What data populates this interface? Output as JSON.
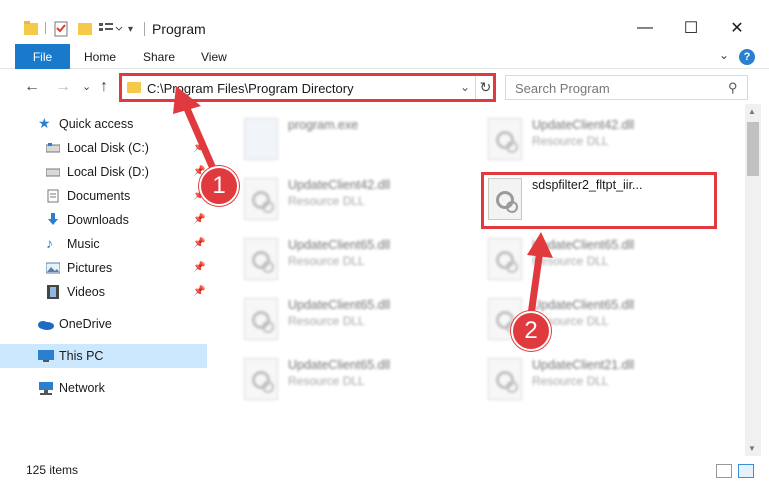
{
  "window": {
    "title": "Program",
    "minimize_glyph": "—",
    "maximize_glyph": "☐",
    "close_glyph": "✕"
  },
  "ribbon": {
    "file_tab": "File",
    "tabs": [
      "Home",
      "Share",
      "View"
    ],
    "help_glyph": "?",
    "expand_glyph": "⌄"
  },
  "nav": {
    "back_glyph": "←",
    "forward_glyph": "→",
    "recent_glyph": "⌄",
    "up_glyph": "↑",
    "address": "C:\\Program Files\\Program Directory",
    "address_drop_glyph": "⌄",
    "refresh_glyph": "↻",
    "search_placeholder": "Search Program",
    "search_glyph": "⚲"
  },
  "sidebar": {
    "items": [
      {
        "label": "Quick access",
        "icon": "star-icon",
        "pinned": false
      },
      {
        "label": "Local Disk (C:)",
        "icon": "drive-icon",
        "pinned": true
      },
      {
        "label": "Local Disk (D:)",
        "icon": "drive-icon",
        "pinned": true
      },
      {
        "label": "Documents",
        "icon": "documents-icon",
        "pinned": true
      },
      {
        "label": "Downloads",
        "icon": "downloads-icon",
        "pinned": true
      },
      {
        "label": "Music",
        "icon": "music-icon",
        "pinned": true
      },
      {
        "label": "Pictures",
        "icon": "pictures-icon",
        "pinned": true
      },
      {
        "label": "Videos",
        "icon": "videos-icon",
        "pinned": true
      },
      {
        "label": "OneDrive",
        "icon": "onedrive-icon",
        "pinned": false
      },
      {
        "label": "This PC",
        "icon": "this-pc-icon",
        "pinned": false,
        "selected": true
      },
      {
        "label": "Network",
        "icon": "network-icon",
        "pinned": false
      }
    ],
    "pin_glyph": "📌"
  },
  "files": [
    {
      "name": "program.exe",
      "type": "",
      "blurred": true
    },
    {
      "name": "UpdateClient42.dll",
      "type": "Resource DLL",
      "blurred": true
    },
    {
      "name": "UpdateClient42.dll",
      "type": "Resource DLL",
      "blurred": true
    },
    {
      "name": "sdspfilter2_fltpt_iir...",
      "type": "",
      "blurred": false
    },
    {
      "name": "UpdateClient65.dll",
      "type": "Resource DLL",
      "blurred": true
    },
    {
      "name": "UpdateClient65.dll",
      "type": "Resource DLL",
      "blurred": true
    },
    {
      "name": "UpdateClient65.dll",
      "type": "Resource DLL",
      "blurred": true
    },
    {
      "name": "UpdateClient65.dll",
      "type": "Resource DLL",
      "blurred": true
    },
    {
      "name": "UpdateClient65.dll",
      "type": "Resource DLL",
      "blurred": true
    },
    {
      "name": "UpdateClient21.dll",
      "type": "Resource DLL",
      "blurred": true
    }
  ],
  "status": {
    "item_count": "125 items"
  },
  "annotations": {
    "badge_1": "1",
    "badge_2": "2",
    "highlight_color": "#e03a3e"
  },
  "colors": {
    "accent": "#1979ca",
    "selection": "#cce8ff",
    "folder": "#f5c94a"
  }
}
